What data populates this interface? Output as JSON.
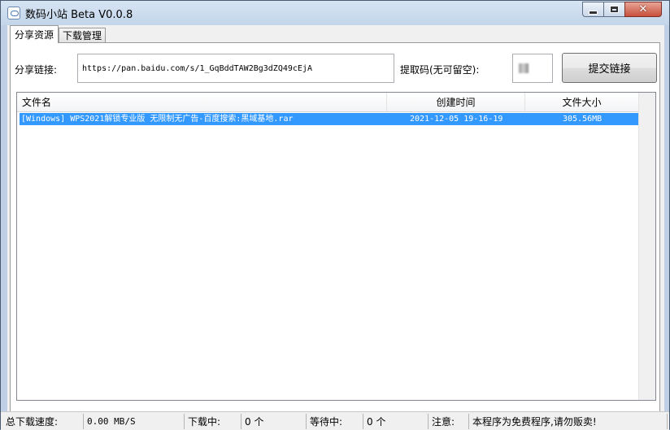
{
  "window": {
    "title": "数码小站 Beta V0.0.8"
  },
  "tabs": [
    {
      "label": "分享资源",
      "active": true
    },
    {
      "label": "下载管理",
      "active": false
    }
  ],
  "share": {
    "link_label": "分享链接:",
    "link_value": "https://pan.baidu.com/s/1_GqBddTAW2Bg3dZQ49cEjA",
    "code_label": "提取码(无可留空):",
    "code_value": "",
    "submit_label": "提交链接"
  },
  "file_list": {
    "columns": [
      "文件名",
      "创建时间",
      "文件大小"
    ],
    "rows": [
      {
        "name": "[Windows] WPS2021解锁专业版 无限制无广告-百度搜索:黑域基地.rar",
        "created": "2021-12-05 19-16-19",
        "size": "305.56MB",
        "selected": true
      }
    ]
  },
  "status_bar": {
    "speed_label": "总下载速度:",
    "speed_value": "0.00 MB/S",
    "downloading_label": "下载中:",
    "downloading_value": "0 个",
    "waiting_label": "等待中:",
    "waiting_value": "0 个",
    "notice_label": "注意:",
    "notice_value": "本程序为免费程序,请勿贩卖!"
  },
  "colors": {
    "selection": "#3399ff",
    "frame": "#bfd0e6"
  }
}
